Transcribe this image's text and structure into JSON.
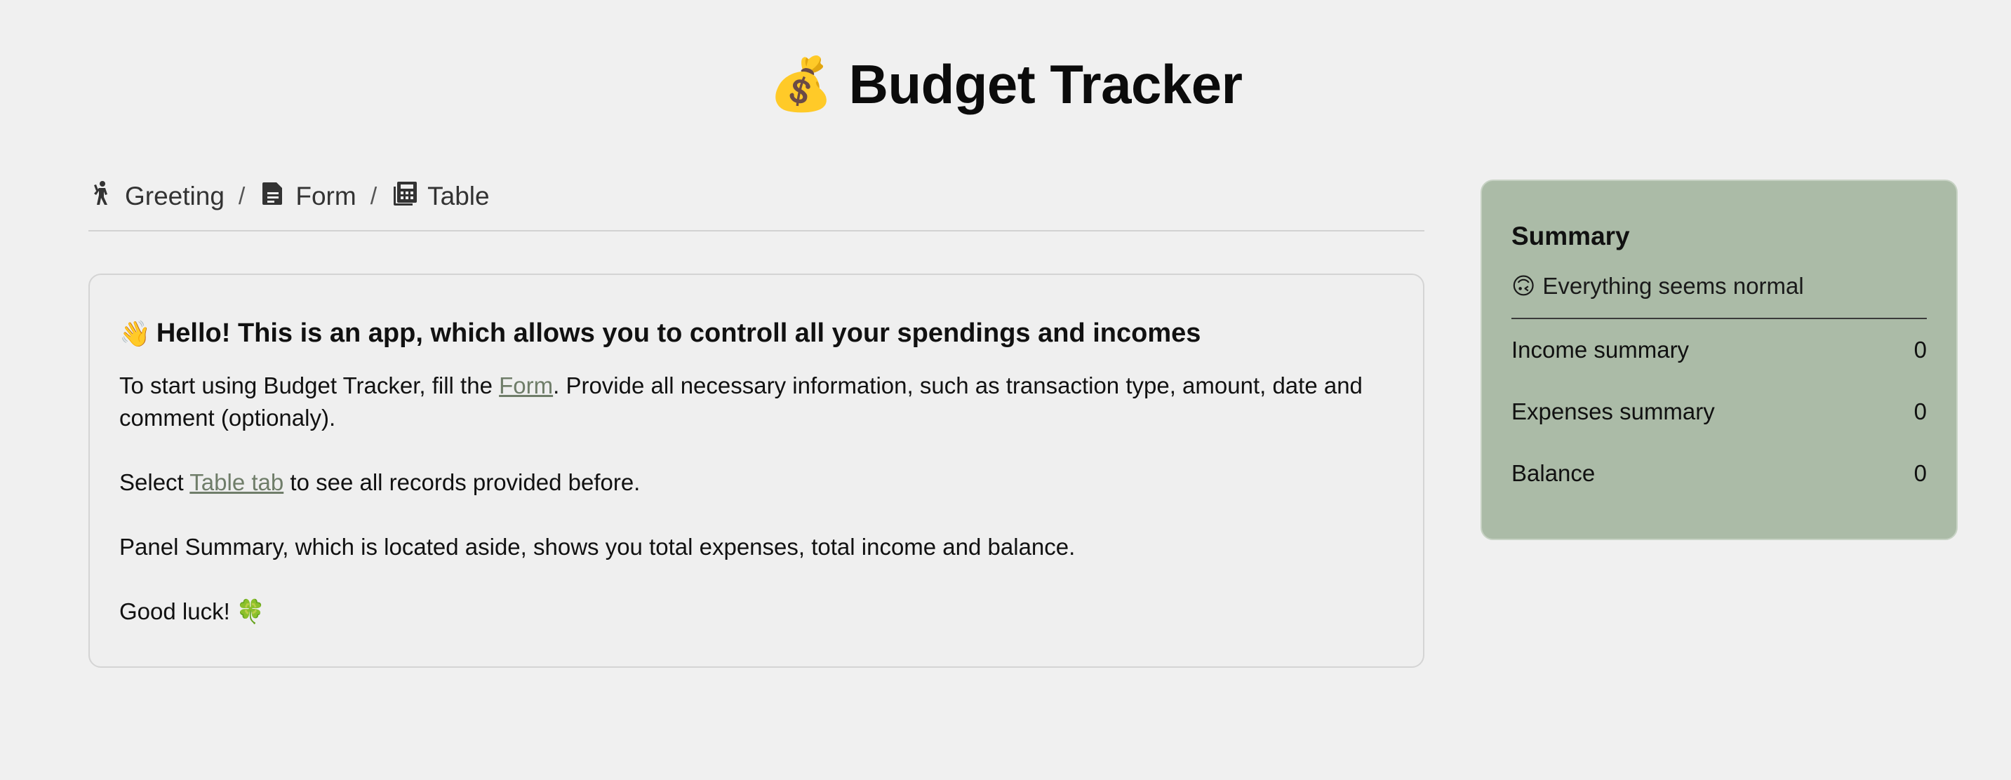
{
  "header": {
    "emoji": "💰",
    "title": "Budget Tracker"
  },
  "breadcrumb": {
    "items": [
      {
        "label": "Greeting",
        "icon": "person-walking-icon"
      },
      {
        "label": "Form",
        "icon": "document-icon"
      },
      {
        "label": "Table",
        "icon": "calculator-icon"
      }
    ],
    "separator": "/"
  },
  "greeting": {
    "emoji": "👋",
    "heading": "Hello! This is an app, which allows you to controll all your spendings and incomes",
    "p1_before": "To start using Budget Tracker, fill the ",
    "p1_link": "Form",
    "p1_after": ". Provide all necessary information, such as transaction type, amount, date and comment (optionaly).",
    "p2_before": "Select ",
    "p2_link": "Table tab",
    "p2_after": " to see all records provided before.",
    "p3": "Panel Summary, which is located aside, shows you total expenses, total income and balance.",
    "p4": "Good luck! 🍀"
  },
  "summary": {
    "title": "Summary",
    "status_emoji": "🙃",
    "status_text": "Everything seems normal",
    "rows": [
      {
        "label": "Income summary",
        "value": "0"
      },
      {
        "label": "Expenses summary",
        "value": "0"
      },
      {
        "label": "Balance",
        "value": "0"
      }
    ]
  },
  "colors": {
    "background": "#f0f0f0",
    "summary_panel": "#abbba7",
    "link": "#6f7d69"
  }
}
